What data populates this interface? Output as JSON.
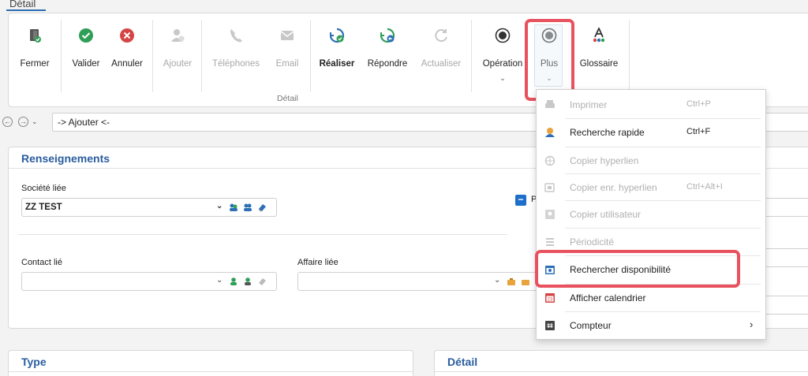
{
  "tab": {
    "label": "Détail"
  },
  "ribbon": {
    "buttons": {
      "fermer": "Fermer",
      "valider": "Valider",
      "annuler": "Annuler",
      "ajouter": "Ajouter",
      "telephones": "Téléphones",
      "email": "Email",
      "realiser": "Réaliser",
      "repondre": "Répondre",
      "actualiser": "Actualiser",
      "operation": "Opération",
      "plus": "Plus",
      "glossaire": "Glossaire"
    },
    "group_label": "Détail",
    "caret": "⌄"
  },
  "nav": {
    "back": "←",
    "forward": "→",
    "dropdown": "⌄",
    "value": "-> Ajouter <-"
  },
  "renseignements": {
    "title": "Renseignements",
    "societe_label": "Société liée",
    "societe_value": "ZZ TEST",
    "contact_label": "Contact lié",
    "affaire_label": "Affaire liée",
    "checkbox_label": "P",
    "dropdown": "⌄"
  },
  "type_panel": {
    "title": "Type"
  },
  "detail_panel": {
    "title": "Détail"
  },
  "menu": {
    "imprimer": {
      "label": "Imprimer",
      "shortcut": "Ctrl+P"
    },
    "recherche_rapide": {
      "label": "Recherche rapide",
      "shortcut": "Ctrl+F"
    },
    "copier_hyperlien": {
      "label": "Copier hyperlien"
    },
    "copier_enr": {
      "label": "Copier enr. hyperlien",
      "shortcut": "Ctrl+Alt+I"
    },
    "copier_utilisateur": {
      "label": "Copier utilisateur"
    },
    "periodicite": {
      "label": "Périodicité"
    },
    "rechercher_dispo": {
      "label": "Rechercher disponibilité"
    },
    "afficher_calendrier": {
      "label": "Afficher calendrier"
    },
    "compteur": {
      "label": "Compteur",
      "arrow": "›"
    }
  },
  "colors": {
    "accent": "#2a5d9f",
    "highlight": "#e8525f",
    "success": "#2f9e57",
    "danger": "#d64545"
  }
}
